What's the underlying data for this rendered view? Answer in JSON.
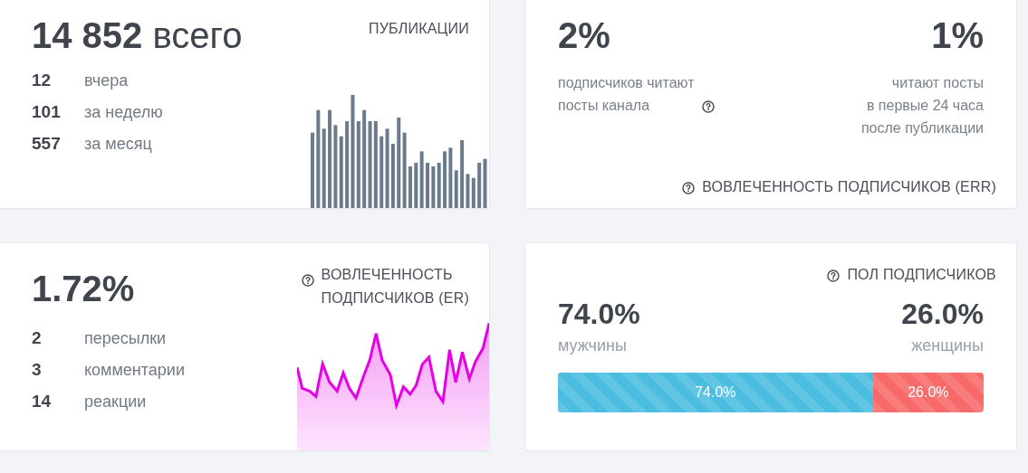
{
  "publications": {
    "title": "ПУБЛИКАЦИИ",
    "total": "14 852",
    "total_unit": "всего",
    "rows": [
      {
        "value": "12",
        "label": "вчера"
      },
      {
        "value": "101",
        "label": "за неделю"
      },
      {
        "value": "557",
        "label": "за месяц"
      }
    ]
  },
  "err": {
    "stats": [
      {
        "value": "2%",
        "caption_lines": [
          "подписчиков читают",
          "посты канала"
        ],
        "help": true
      },
      {
        "value": "1%",
        "caption_lines": [
          "читают посты",
          "в первые 24 часа",
          "после публикации"
        ],
        "help": false
      }
    ],
    "title": "ВОВЛЕЧЕННОСТЬ ПОДПИСЧИКОВ (ERR)"
  },
  "er": {
    "value": "1.72%",
    "title_lines": [
      "ВОВЛЕЧЕННОСТЬ",
      "ПОДПИСЧИКОВ (ER)"
    ],
    "rows": [
      {
        "value": "2",
        "label": "пересылки"
      },
      {
        "value": "3",
        "label": "комментарии"
      },
      {
        "value": "14",
        "label": "реакции"
      }
    ]
  },
  "gender": {
    "title": "ПОЛ ПОДПИСЧИКОВ",
    "segments": [
      {
        "value": "74.0%",
        "label": "мужчины",
        "bar_label": "74.0%",
        "level": 0.74,
        "color": "#4bbde0"
      },
      {
        "value": "26.0%",
        "label": "женщины",
        "bar_label": "26.0%",
        "color": "#f86a6a"
      }
    ]
  }
}
